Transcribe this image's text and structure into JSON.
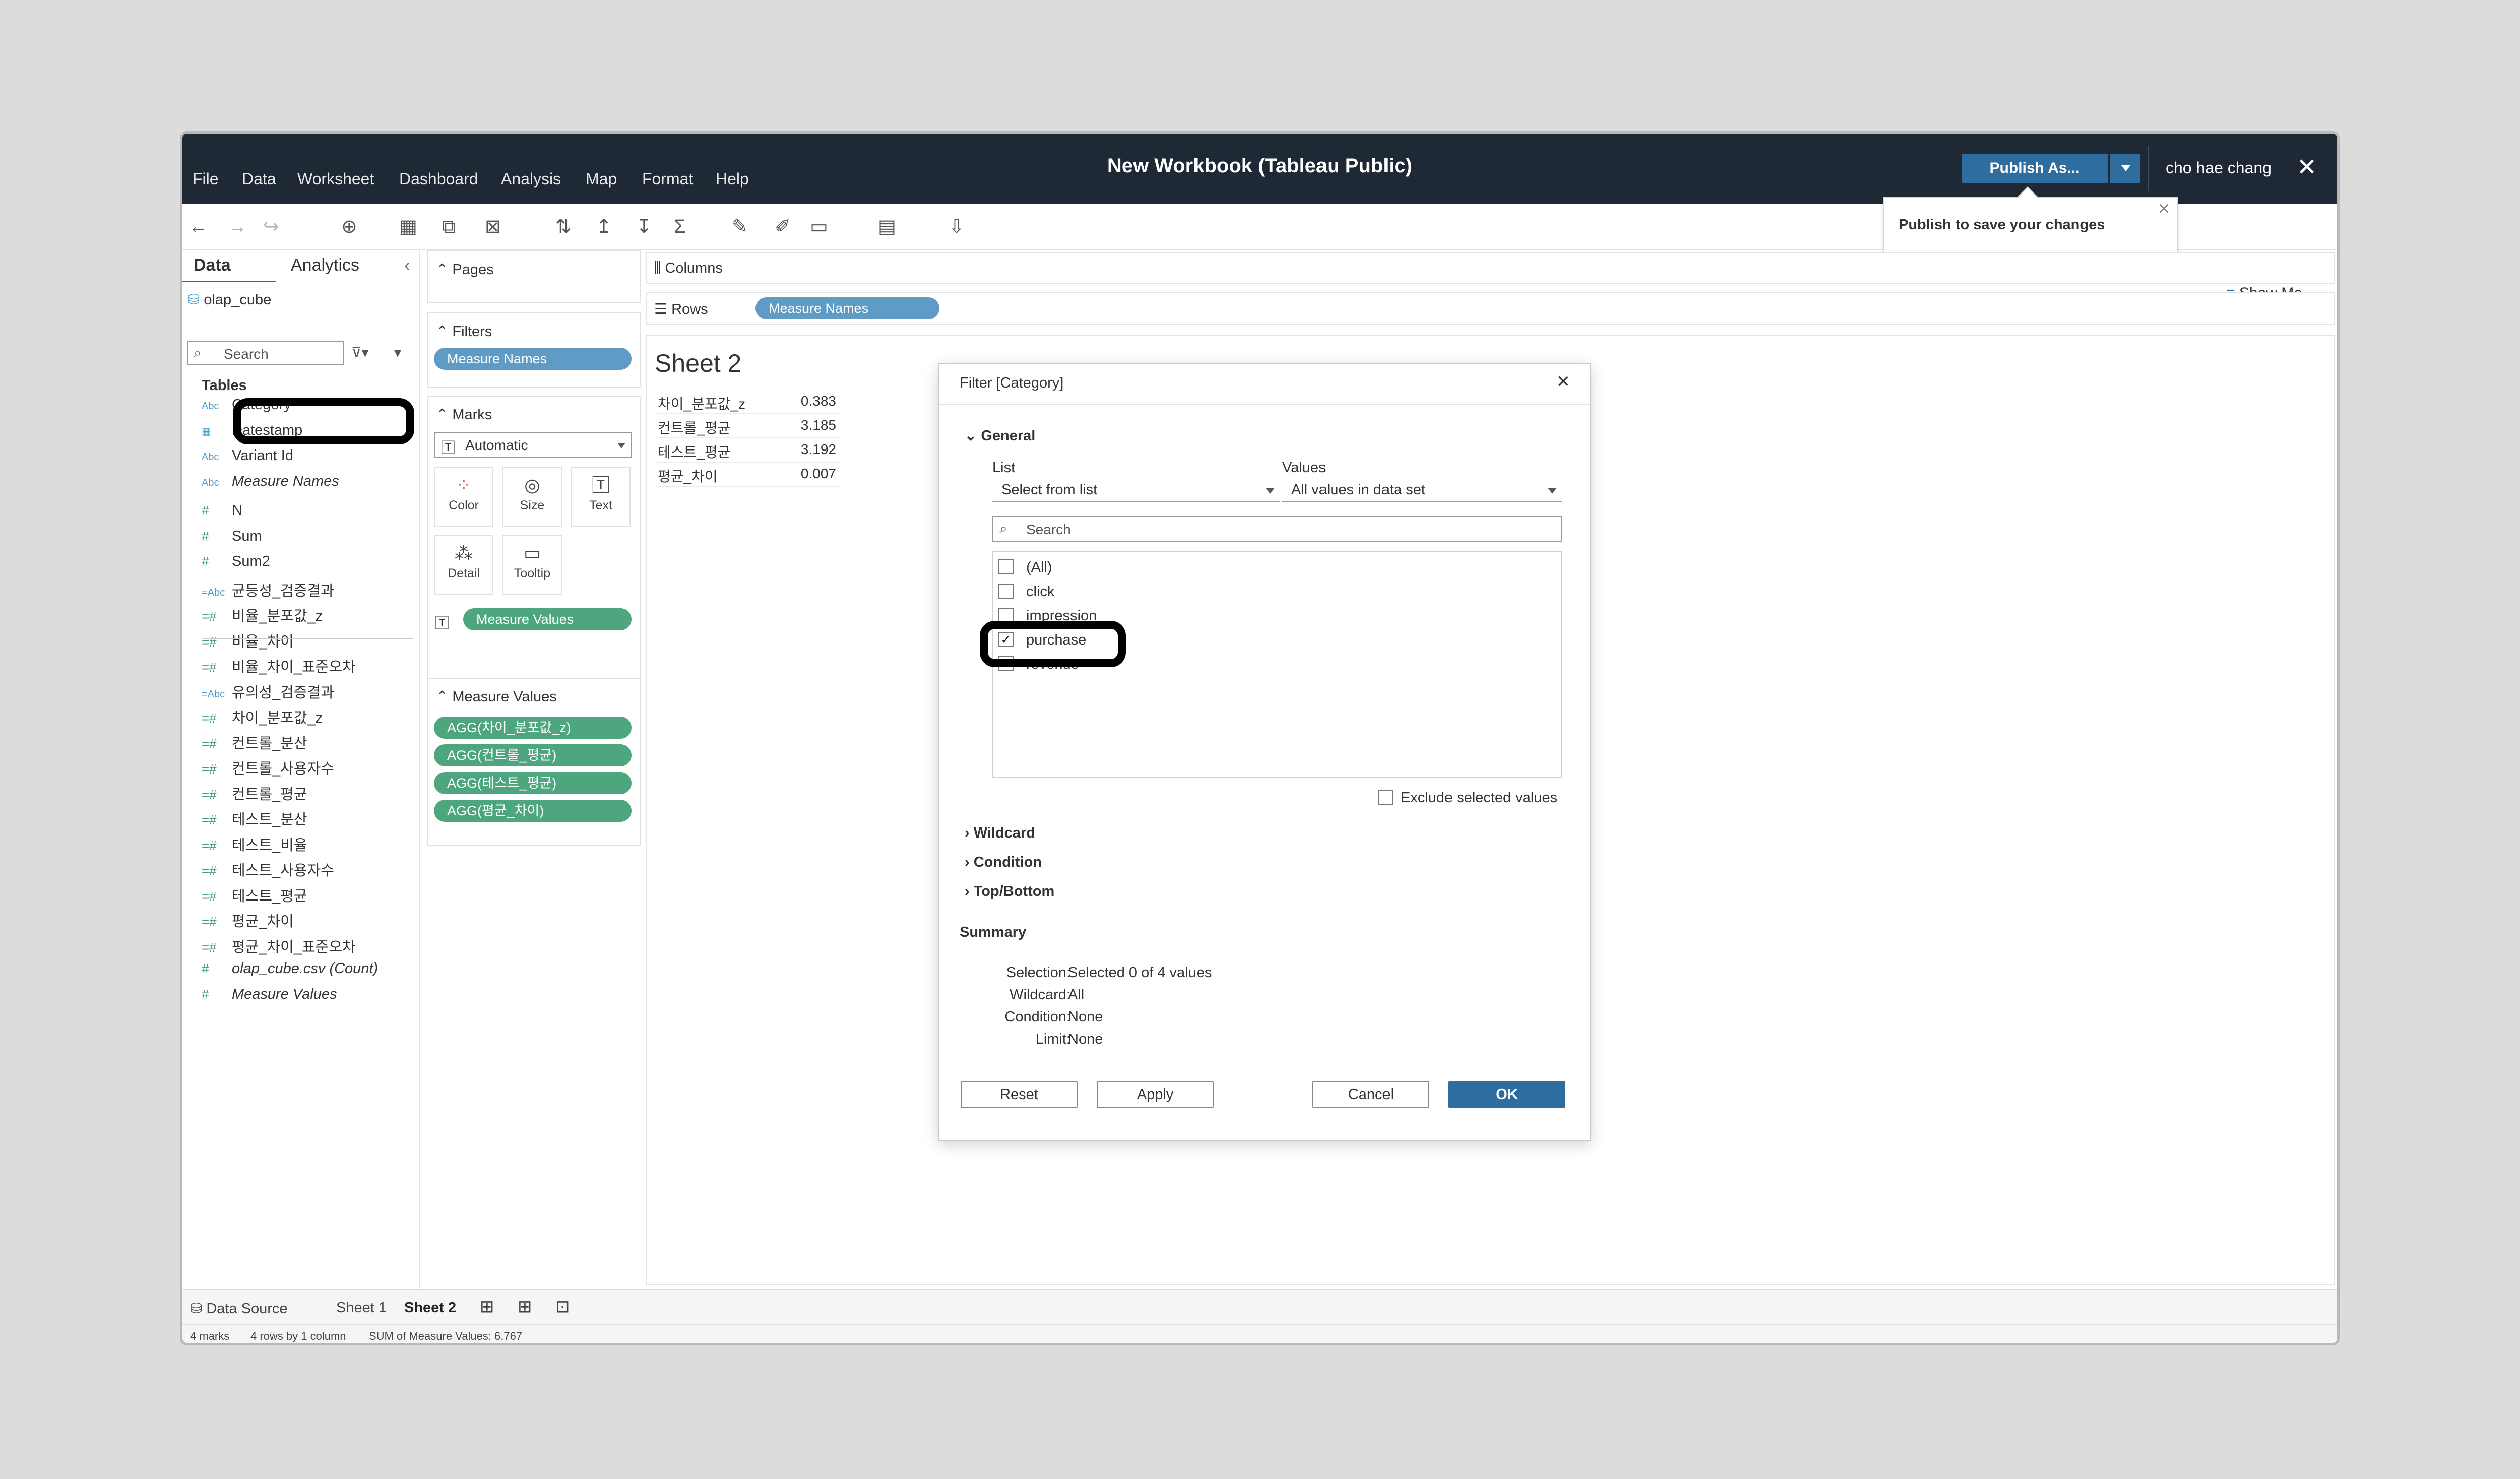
{
  "window": {
    "title": "New Workbook (Tableau Public)",
    "menu": [
      "File",
      "Data",
      "Worksheet",
      "Dashboard",
      "Analysis",
      "Map",
      "Format",
      "Help"
    ],
    "publish_label": "Publish As...",
    "user": "cho hae chang",
    "publish_tooltip": "Publish to save your changes",
    "show_me": "Show Me"
  },
  "data_pane": {
    "tabs": [
      "Data",
      "Analytics"
    ],
    "datasource": "olap_cube",
    "search_placeholder": "Search",
    "tables_heading": "Tables",
    "fields": [
      {
        "icon": "Abc",
        "name": "Category"
      },
      {
        "icon": "calendar",
        "name": "Datestamp"
      },
      {
        "icon": "Abc",
        "name": "Variant Id"
      },
      {
        "icon": "Abc",
        "name": "Measure Names"
      },
      {
        "icon": "#",
        "name": "N"
      },
      {
        "icon": "#",
        "name": "Sum"
      },
      {
        "icon": "#",
        "name": "Sum2"
      },
      {
        "icon": "=Abc",
        "name": "균등성_검증결과"
      },
      {
        "icon": "=#",
        "name": "비율_분포값_z"
      },
      {
        "icon": "=#",
        "name": "비율_차이"
      },
      {
        "icon": "=#",
        "name": "비율_차이_표준오차"
      },
      {
        "icon": "=Abc",
        "name": "유의성_검증결과"
      },
      {
        "icon": "=#",
        "name": "차이_분포값_z"
      },
      {
        "icon": "=#",
        "name": "컨트롤_분산"
      },
      {
        "icon": "=#",
        "name": "컨트롤_사용자수"
      },
      {
        "icon": "=#",
        "name": "컨트롤_평균"
      },
      {
        "icon": "=#",
        "name": "테스트_분산"
      },
      {
        "icon": "=#",
        "name": "테스트_비율"
      },
      {
        "icon": "=#",
        "name": "테스트_사용자수"
      },
      {
        "icon": "=#",
        "name": "테스트_평균"
      },
      {
        "icon": "=#",
        "name": "평균_차이"
      },
      {
        "icon": "=#",
        "name": "평균_차이_표준오차"
      },
      {
        "icon": "#",
        "name": "olap_cube.csv (Count)"
      },
      {
        "icon": "#",
        "name": "Measure Values"
      }
    ]
  },
  "cards": {
    "pages": "Pages",
    "filters": "Filters",
    "filter_pill": "Measure Names",
    "marks": "Marks",
    "mark_type": "Automatic",
    "mark_buttons": [
      "Color",
      "Size",
      "Text",
      "Detail",
      "Tooltip"
    ],
    "marks_text_pill": "Measure Values",
    "measure_values": "Measure Values",
    "measure_pills": [
      "AGG(차이_분포값_z)",
      "AGG(컨트롤_평균)",
      "AGG(테스트_평균)",
      "AGG(평균_차이)"
    ]
  },
  "shelves": {
    "columns": "Columns",
    "rows": "Rows",
    "rows_pill": "Measure Names"
  },
  "sheet": {
    "title": "Sheet 2",
    "rows": [
      {
        "name": "차이_분포값_z",
        "value": "0.383"
      },
      {
        "name": "컨트롤_평균",
        "value": "3.185"
      },
      {
        "name": "테스트_평균",
        "value": "3.192"
      },
      {
        "name": "평균_차이",
        "value": "0.007"
      }
    ]
  },
  "dialog": {
    "title": "Filter [Category]",
    "general": "General",
    "list_label": "List",
    "list_value": "Select from list",
    "values_label": "Values",
    "values_value": "All values in data set",
    "search_placeholder": "Search",
    "items": [
      {
        "label": "(All)",
        "checked": false
      },
      {
        "label": "click",
        "checked": false
      },
      {
        "label": "impression",
        "checked": false
      },
      {
        "label": "purchase",
        "checked": true
      },
      {
        "label": "revenue",
        "checked": false
      }
    ],
    "exclude": "Exclude selected values",
    "sections": [
      "Wildcard",
      "Condition",
      "Top/Bottom"
    ],
    "summary_heading": "Summary",
    "summary": [
      {
        "k": "Selection:",
        "v": "Selected 0 of 4 values"
      },
      {
        "k": "Wildcard:",
        "v": "All"
      },
      {
        "k": "Condition:",
        "v": "None"
      },
      {
        "k": "Limit:",
        "v": "None"
      }
    ],
    "buttons": {
      "reset": "Reset",
      "apply": "Apply",
      "cancel": "Cancel",
      "ok": "OK"
    }
  },
  "bottom": {
    "data_source": "Data Source",
    "sheets": [
      "Sheet 1",
      "Sheet 2"
    ],
    "status": [
      "4 marks",
      "4 rows by 1 column",
      "SUM of Measure Values: 6.767"
    ]
  },
  "colors": {
    "titlebar": "#1f2936",
    "accent": "#2f6d9e",
    "dimension_pill": "#5f9bc4",
    "measure_pill": "#4ea67f"
  }
}
